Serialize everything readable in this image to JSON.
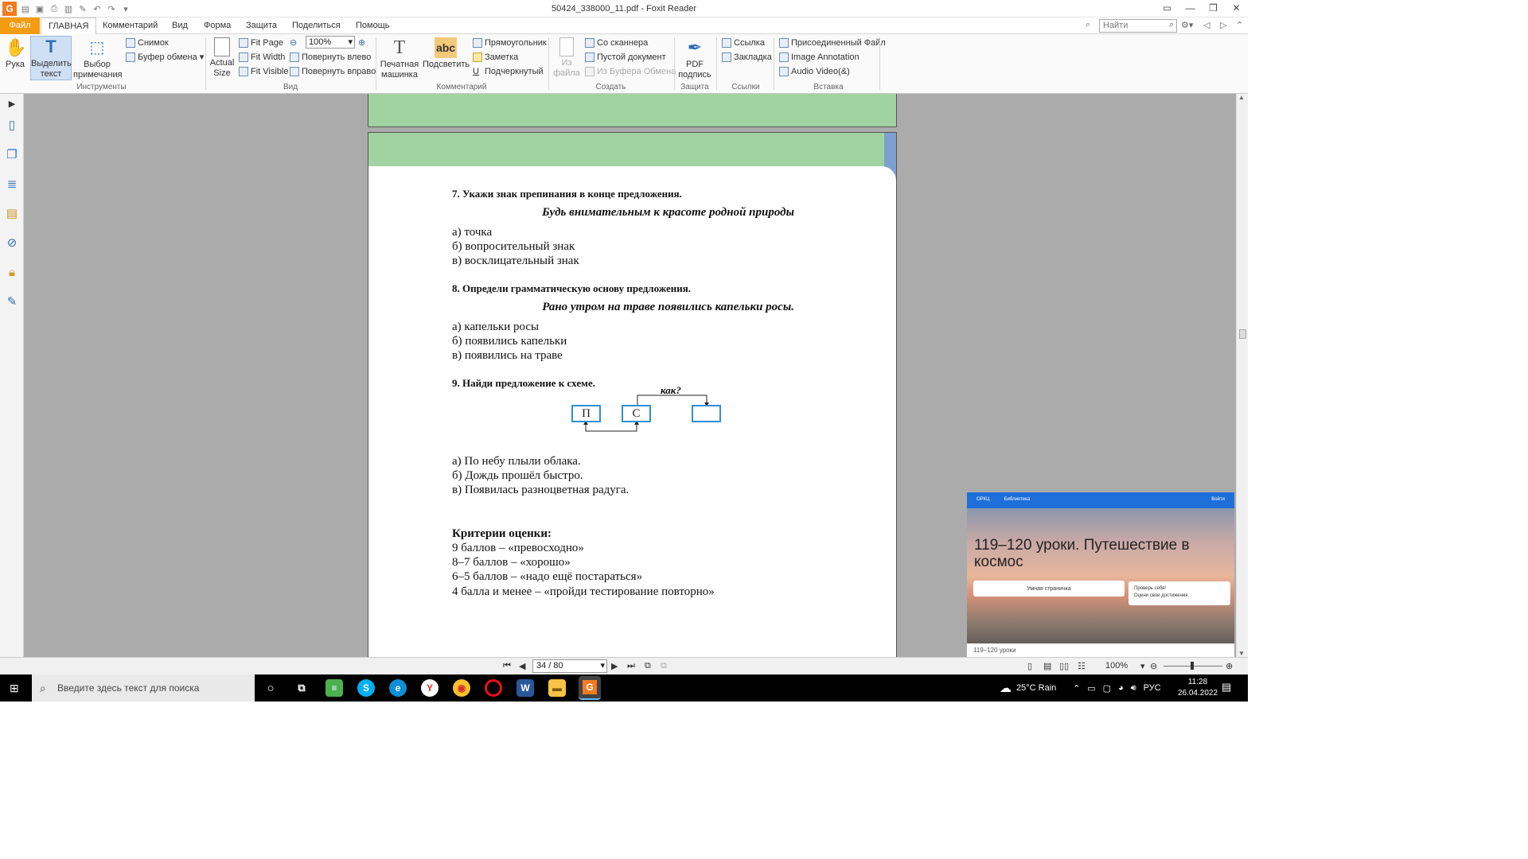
{
  "window": {
    "title": "50424_338000_11.pdf - Foxit Reader",
    "app_icon": "G",
    "controls": [
      "▭",
      "—",
      "❐",
      "✕"
    ]
  },
  "menu": {
    "file": "Файл",
    "tabs": [
      "ГЛАВНАЯ",
      "Комментарий",
      "Вид",
      "Форма",
      "Защита",
      "Поделиться",
      "Помощь"
    ],
    "search_placeholder": "Найти"
  },
  "ribbon": {
    "tools": {
      "hand": "Рука",
      "select_text": "Выделить текст",
      "select_annotation": "Выбор примечания",
      "snapshot": "Снимок",
      "clipboard": "Буфер обмена",
      "group": "Инструменты"
    },
    "view": {
      "actual_size": "Actual Size",
      "fit_page": "Fit Page",
      "fit_width": "Fit Width",
      "fit_visible": "Fit Visible",
      "zoom": "100%",
      "rotate_left": "Повернуть влево",
      "rotate_right": "Повернуть вправо",
      "group": "Вид"
    },
    "comment": {
      "typewriter": "Печатная машинка",
      "highlight": "Подсветить",
      "highlight_icon": "abc",
      "rectangle": "Прямоугольник",
      "note": "Заметка",
      "underline": "Подчеркнутый",
      "group": "Комментарий"
    },
    "create": {
      "from_file": "Из файла",
      "from_scanner": "Со сканнера",
      "blank": "Пустой документ",
      "from_clipboard": "Из Буфера Обмена",
      "group": "Создать"
    },
    "protect": {
      "pdf_sign": "PDF подпись",
      "group": "Защита"
    },
    "links": {
      "link": "Ссылка",
      "bookmark": "Закладка",
      "group": "Ссылки"
    },
    "insert": {
      "attached_file": "Присоединенный Файл",
      "image_annotation": "Image Annotation",
      "audio_video": "Audio  Video(&)",
      "group": "Вставка"
    }
  },
  "document": {
    "q7": {
      "title": "7. Укажи знак препинания в конце предложения.",
      "sentence": "Будь внимательным к красоте родной природы",
      "options": [
        "а) точка",
        "б) вопросительный знак",
        "в) восклицательный знак"
      ]
    },
    "q8": {
      "title": "8. Определи грамматическую основу предложения.",
      "sentence": "Рано утром на траве появились капельки росы.",
      "options": [
        "а) капельки росы",
        "б) появились капельки",
        "в) появились на траве"
      ]
    },
    "q9": {
      "title": "9. Найди предложение к схеме.",
      "schema_question": "как?",
      "box1": "П",
      "box2": "С",
      "options": [
        "а) По небу плыли облака.",
        "б) Дождь прошёл быстро.",
        "в) Появилась разноцветная радуга."
      ]
    },
    "criteria": {
      "title": "Критерии оценки:",
      "lines": [
        "9 баллов – «превосходно»",
        "8–7 баллов – «хорошо»",
        "6–5 баллов – «надо ещё постараться»",
        "4 балла и менее – «пройди тестирование повторно»"
      ]
    }
  },
  "video_overlay": {
    "brand": "ОРКЦ",
    "nav": "Библиотека",
    "login": "Войти",
    "title": "119–120 уроки. Путешествие в космос",
    "button": "Умная страничка",
    "card_line1": "Проверь себя!",
    "card_line2": "Оцени свои достижения.",
    "footer": "119–120 уроки"
  },
  "statusbar": {
    "page": "34 / 80",
    "zoom": "100%"
  },
  "taskbar": {
    "search_placeholder": "Введите здесь текст для поиска",
    "weather": "25°C  Rain",
    "lang": "РУС",
    "time": "11:28",
    "date": "26.04.2022"
  },
  "colors": {
    "accent_orange": "#f39c12",
    "page_green": "#a1d3a0",
    "schema_blue": "#2f8fd8",
    "ribbon_blue": "#2f6fb3"
  }
}
